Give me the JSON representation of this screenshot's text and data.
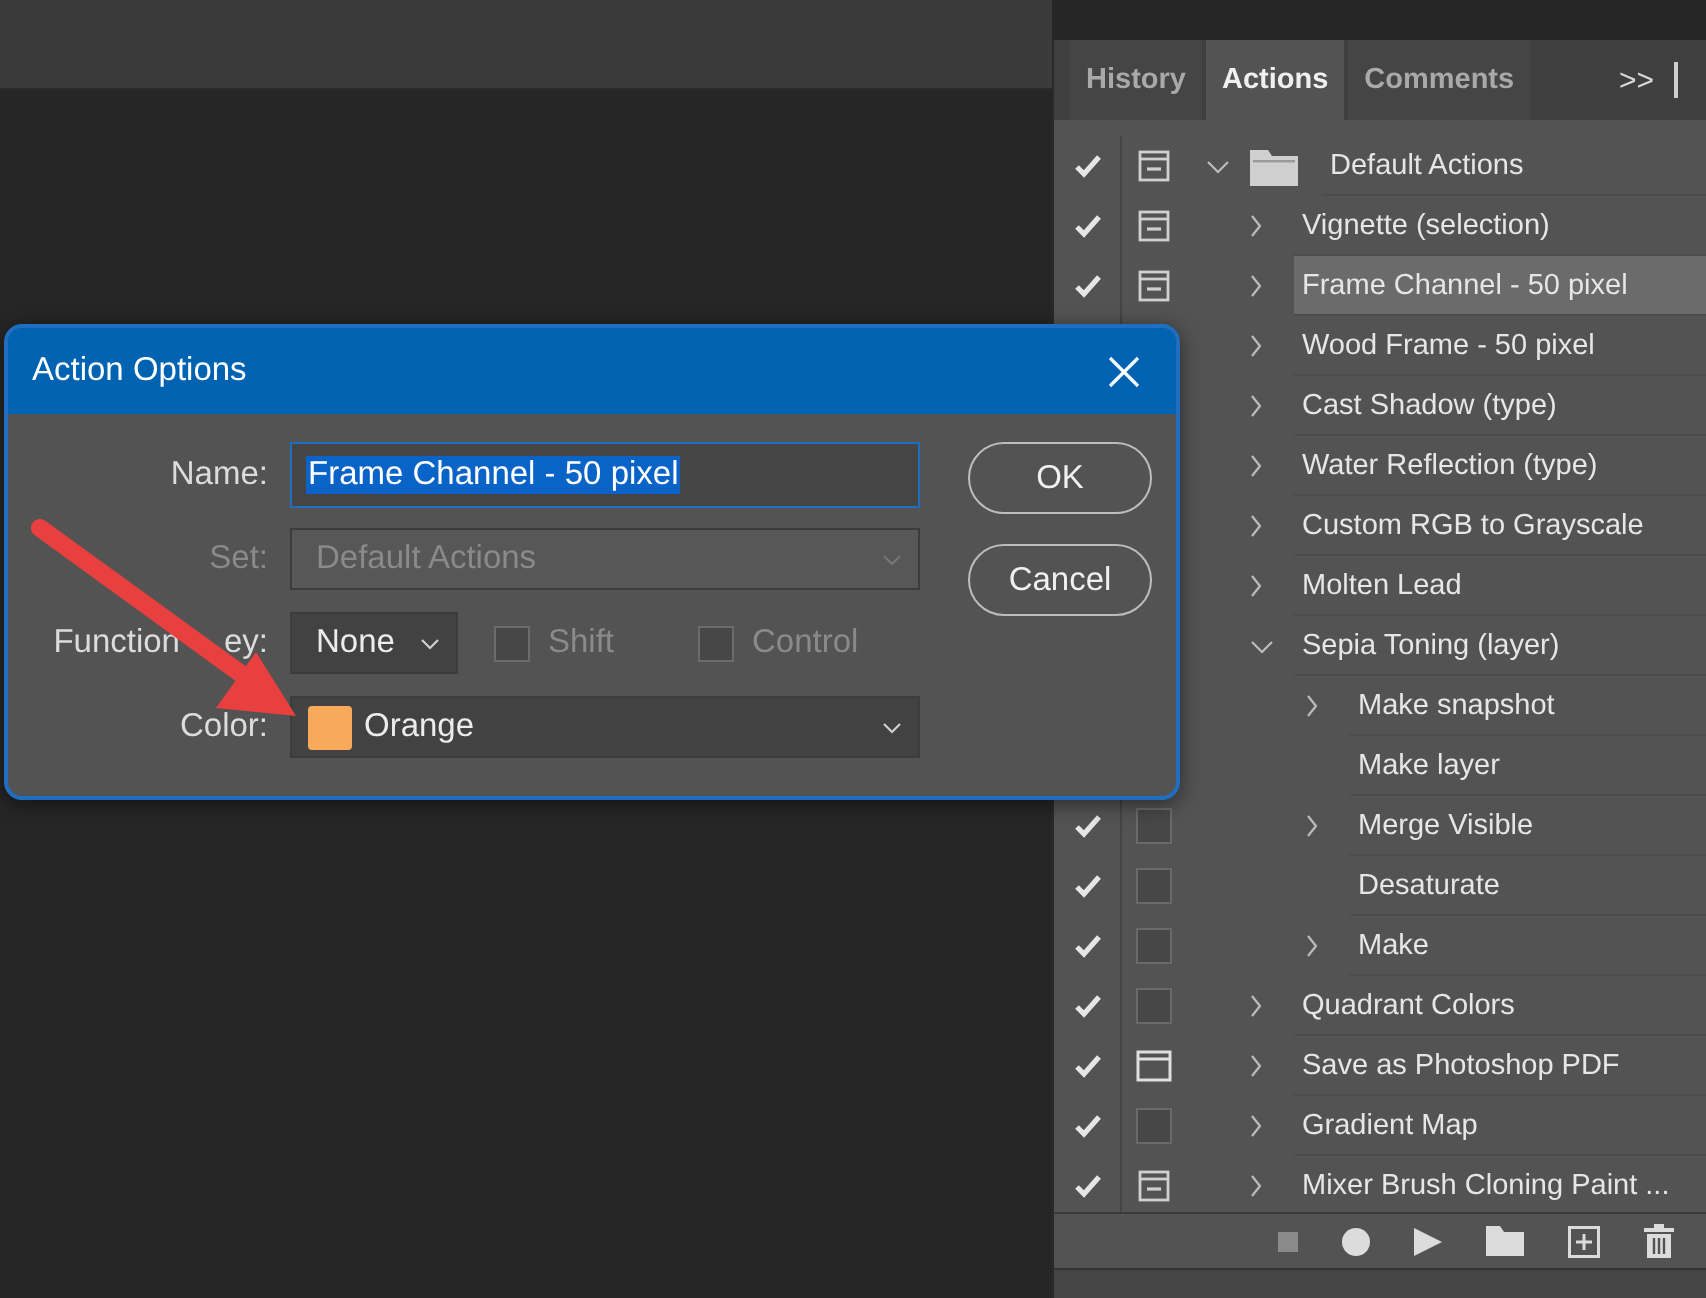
{
  "panel": {
    "tabs": [
      {
        "label": "History",
        "selected": false
      },
      {
        "label": "Actions",
        "selected": true
      },
      {
        "label": "Comments",
        "selected": false
      }
    ],
    "menu": ">>",
    "actions": [
      {
        "label": "Default Actions",
        "kind": "set",
        "checked": true,
        "dialog_on": true,
        "dialog_all": false,
        "expanded": true,
        "selected": false,
        "children": [
          {
            "label": "Vignette (selection)",
            "checked": true,
            "dialog_on": true,
            "dialog_all": false,
            "expanded": false,
            "selected": false
          },
          {
            "label": "Frame Channel - 50 pixel",
            "checked": true,
            "dialog_on": true,
            "dialog_all": false,
            "expanded": false,
            "selected": true
          },
          {
            "label": "Wood Frame - 50 pixel",
            "expanded": false,
            "selected": false
          },
          {
            "label": "Cast Shadow (type)",
            "expanded": false,
            "selected": false
          },
          {
            "label": "Water Reflection (type)",
            "expanded": false,
            "selected": false
          },
          {
            "label": "Custom RGB to Grayscale",
            "expanded": false,
            "selected": false
          },
          {
            "label": "Molten Lead",
            "expanded": false,
            "selected": false
          },
          {
            "label": "Sepia Toning (layer)",
            "expanded": true,
            "selected": false,
            "children": [
              {
                "label": "Make snapshot",
                "expanded": false,
                "selected": false
              },
              {
                "label": "Make layer",
                "selected": false
              },
              {
                "label": "Merge Visible",
                "checked": true,
                "dialog_on": false,
                "expanded": false,
                "selected": false
              },
              {
                "label": "Desaturate",
                "checked": true,
                "dialog_on": false,
                "selected": false
              },
              {
                "label": "Make",
                "checked": true,
                "dialog_on": false,
                "expanded": false,
                "selected": false
              }
            ]
          },
          {
            "label": "Quadrant Colors",
            "checked": true,
            "dialog_on": false,
            "expanded": false,
            "selected": false
          },
          {
            "label": "Save as Photoshop PDF",
            "checked": true,
            "dialog_on": true,
            "dialog_all": true,
            "expanded": false,
            "selected": false
          },
          {
            "label": "Gradient Map",
            "checked": true,
            "dialog_on": false,
            "expanded": false,
            "selected": false
          },
          {
            "label": "Mixer Brush Cloning Paint ...",
            "checked": true,
            "dialog_on": true,
            "dialog_all": false,
            "expanded": false,
            "selected": false
          }
        ]
      }
    ]
  },
  "dialog": {
    "title": "Action Options",
    "fields": [
      {
        "kind": "text",
        "label": "Name:",
        "value": "Frame Channel - 50 pixel",
        "text_selected": true,
        "disabled": false
      },
      {
        "kind": "select",
        "label": "Set:",
        "value": "Default Actions",
        "disabled": true
      },
      {
        "kind": "function",
        "label": "Function",
        "label_tail": "ey:",
        "value": "None",
        "disabled": false,
        "checkboxes": [
          {
            "label": "Shift",
            "checked": false,
            "disabled": true
          },
          {
            "label": "Control",
            "checked": false,
            "disabled": true
          }
        ]
      },
      {
        "kind": "color",
        "label": "Color:",
        "value": "Orange",
        "color": "#f8a95b",
        "disabled": false
      }
    ],
    "buttons": [
      "OK",
      "Cancel"
    ]
  }
}
